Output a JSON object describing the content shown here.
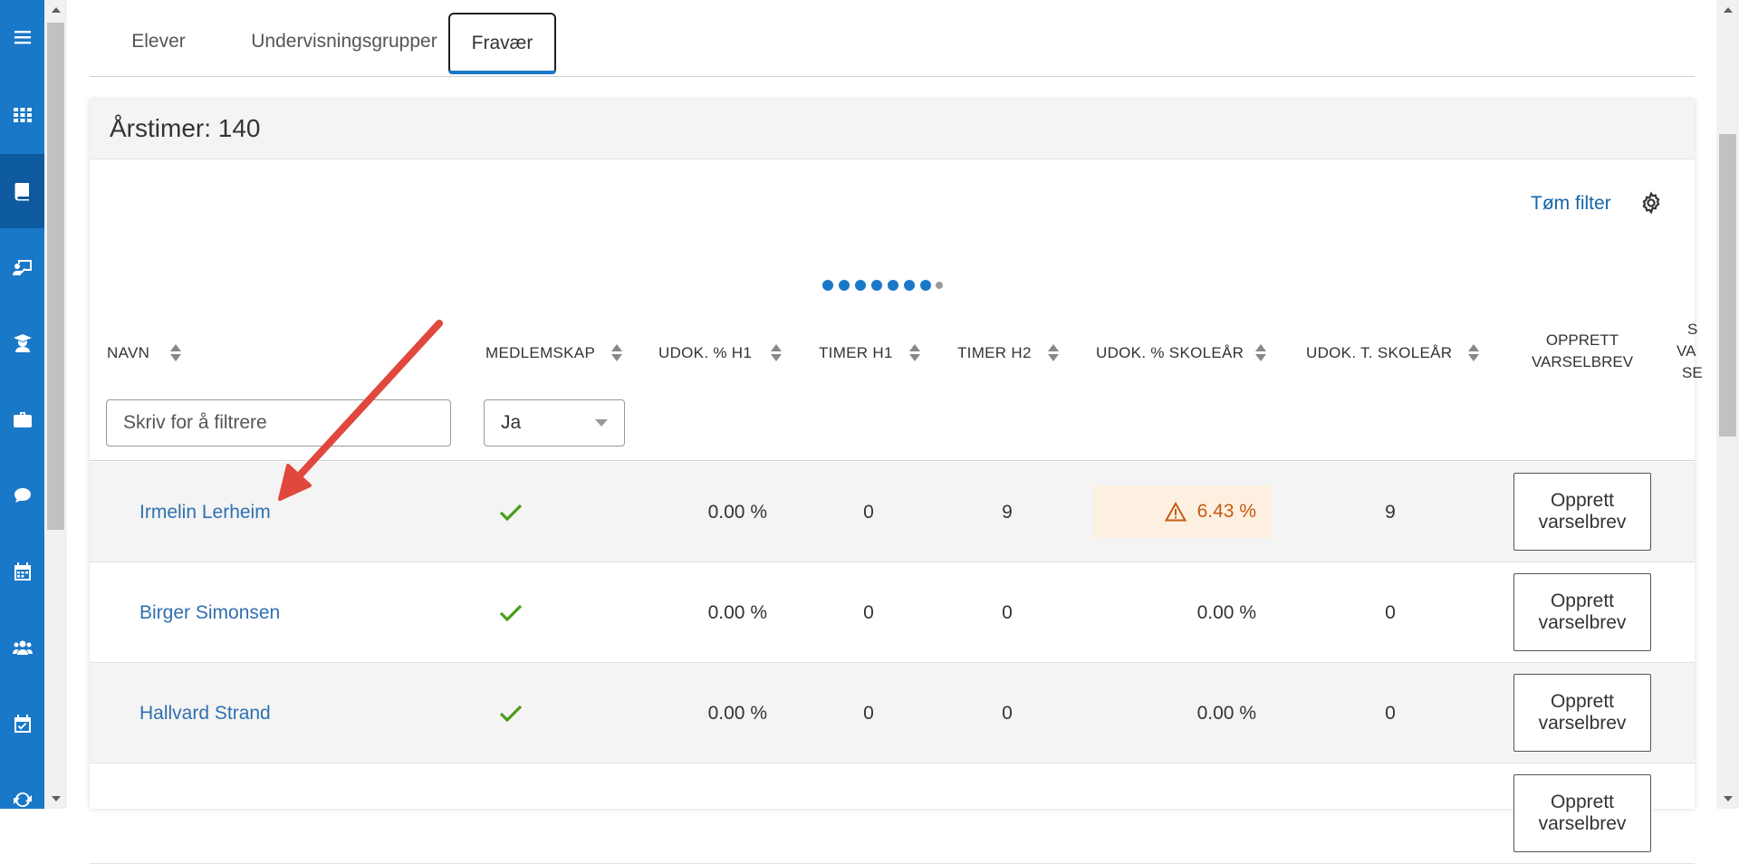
{
  "tabs": [
    {
      "label": "Elever"
    },
    {
      "label": "Undervisningsgrupper"
    },
    {
      "label": "Fravær",
      "active": true
    }
  ],
  "card": {
    "title": "Årstimer: 140",
    "clear_filter": "Tøm filter"
  },
  "columns": {
    "navn": "NAVN",
    "medlemskap": "MEDLEMSKAP",
    "udok_h1": "UDOK. % H1",
    "timer_h1": "TIMER H1",
    "timer_h2": "TIMER H2",
    "udok_skolear": "UDOK. % SKOLEÅR",
    "udok_t_skolear": "UDOK. T. SKOLEÅR",
    "opprett_line1": "OPPRETT",
    "opprett_line2": "VARSELBREV",
    "cut_line1": "S",
    "cut_line2": "VA",
    "cut_line3": "SE"
  },
  "filters": {
    "name_placeholder": "Skriv for å filtrere",
    "medlemskap_value": "Ja"
  },
  "button": {
    "line1": "Opprett",
    "line2": "varselbrev"
  },
  "rows": [
    {
      "name": "Irmelin Lerheim",
      "udok_h1": "0.00 %",
      "timer_h1": "0",
      "timer_h2": "9",
      "udok_skolear": "6.43 %",
      "udok_t_skolear": "9"
    },
    {
      "name": "Birger Simonsen",
      "udok_h1": "0.00 %",
      "timer_h1": "0",
      "timer_h2": "0",
      "udok_skolear": "0.00 %",
      "udok_t_skolear": "0"
    },
    {
      "name": "Hallvard Strand",
      "udok_h1": "0.00 %",
      "timer_h1": "0",
      "timer_h2": "0",
      "udok_skolear": "0.00 %",
      "udok_t_skolear": "0"
    }
  ],
  "colors": {
    "sidebar": "#1a78c8",
    "link": "#2f6fb0",
    "warning": "#c55a11",
    "check": "#4a9e1a",
    "annotation_arrow": "#e0483e"
  }
}
